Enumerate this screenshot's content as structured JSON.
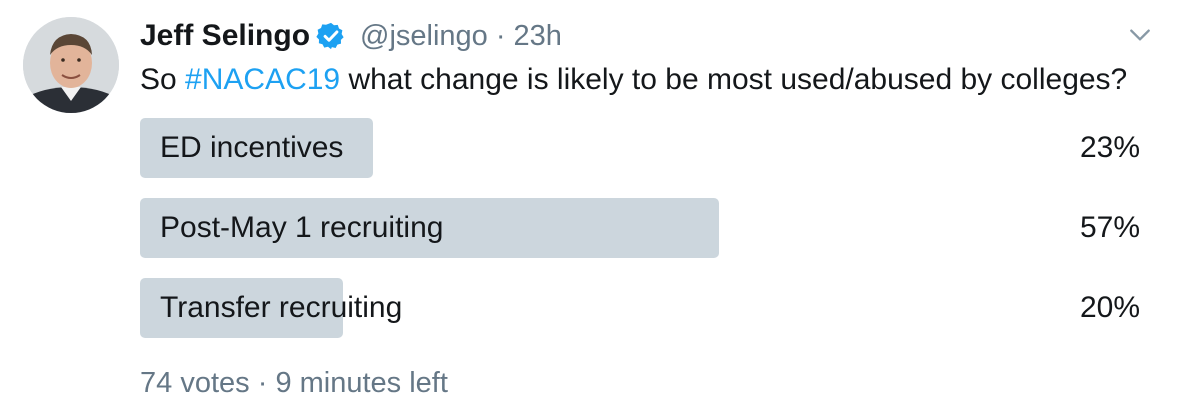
{
  "author": {
    "name": "Jeff Selingo",
    "handle": "@jselingo",
    "separator": "·",
    "time": "23h",
    "verified_icon": "verified-badge-icon",
    "avatar_icon": "user-avatar"
  },
  "tweet": {
    "text_before": "So ",
    "hashtag": "#NACAC19",
    "text_after": " what change is likely to be most used/abused by colleges?"
  },
  "poll": {
    "options": [
      {
        "label": "ED incentives",
        "percent_label": "23%",
        "fill_percent": 23
      },
      {
        "label": "Post-May 1 recruiting",
        "percent_label": "57%",
        "fill_percent": 57
      },
      {
        "label": "Transfer recruiting",
        "percent_label": "20%",
        "fill_percent": 20
      }
    ],
    "votes": "74 votes",
    "separator": "·",
    "time_left": "9 minutes left"
  },
  "menu_icon": "chevron-down-icon",
  "colors": {
    "accent": "#1da1f2",
    "bar": "#ccd6dd",
    "text": "#14171a",
    "secondary": "#657786"
  }
}
